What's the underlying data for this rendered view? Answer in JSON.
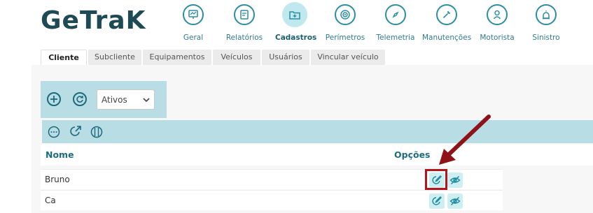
{
  "logo": {
    "text": "GeTraK"
  },
  "nav": {
    "items": [
      {
        "label": "Geral",
        "icon": "monitor-chart-icon"
      },
      {
        "label": "Relatórios",
        "icon": "report-icon"
      },
      {
        "label": "Cadastros",
        "icon": "folder-plus-icon",
        "active": true
      },
      {
        "label": "Perímetros",
        "icon": "target-icon"
      },
      {
        "label": "Telemetria",
        "icon": "compass-icon"
      },
      {
        "label": "Manutenções",
        "icon": "wrench-icon"
      },
      {
        "label": "Motorista",
        "icon": "driver-icon"
      },
      {
        "label": "Sinistro",
        "icon": "alarm-icon"
      }
    ]
  },
  "tabs": [
    "Cliente",
    "Subcliente",
    "Equipamentos",
    "Veículos",
    "Usuários",
    "Vincular veículo"
  ],
  "filter": {
    "selected": "Ativos"
  },
  "table": {
    "columns": {
      "name": "Nome",
      "options": "Opções"
    },
    "rows": [
      {
        "name": "Bruno"
      },
      {
        "name": "Ca"
      }
    ]
  },
  "colors": {
    "accent": "#2b8ea3",
    "toolbar": "#b8dde4",
    "highlight": "#b3161d"
  }
}
